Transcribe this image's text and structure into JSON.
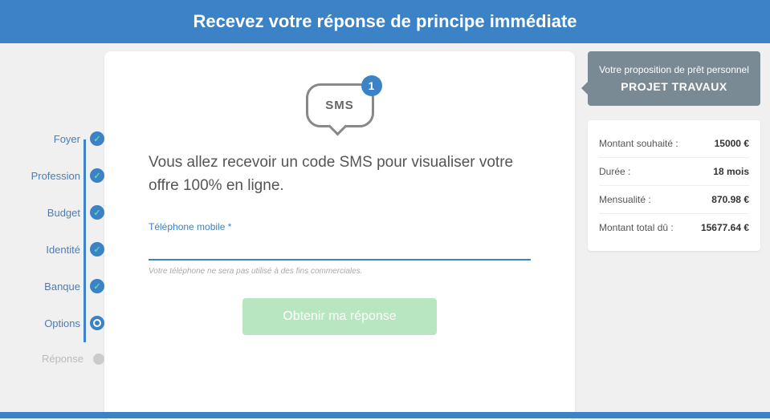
{
  "header": {
    "title": "Recevez votre réponse de principe immédiate"
  },
  "steps": [
    {
      "label": "Foyer",
      "state": "done"
    },
    {
      "label": "Profession",
      "state": "done"
    },
    {
      "label": "Budget",
      "state": "done"
    },
    {
      "label": "Identité",
      "state": "done"
    },
    {
      "label": "Banque",
      "state": "done"
    },
    {
      "label": "Options",
      "state": "current"
    },
    {
      "label": "Réponse",
      "state": "pending"
    }
  ],
  "sms": {
    "label": "SMS",
    "badge": "1"
  },
  "main": {
    "text": "Vous allez recevoir un code SMS pour visualiser votre offre 100% en ligne.",
    "input_label": "Téléphone mobile *",
    "input_value": "",
    "input_hint": "Votre téléphone ne sera pas utilisé à des fins commerciales.",
    "submit": "Obtenir ma réponse"
  },
  "proposal": {
    "sub": "Votre proposition de prêt personnel",
    "title": "PROJET TRAVAUX"
  },
  "summary": [
    {
      "label": "Montant souhaité :",
      "value": "15000 €"
    },
    {
      "label": "Durée :",
      "value": "18 mois"
    },
    {
      "label": "Mensualité :",
      "value": "870.98 €"
    },
    {
      "label": "Montant total dû :",
      "value": "15677.64 €"
    }
  ]
}
